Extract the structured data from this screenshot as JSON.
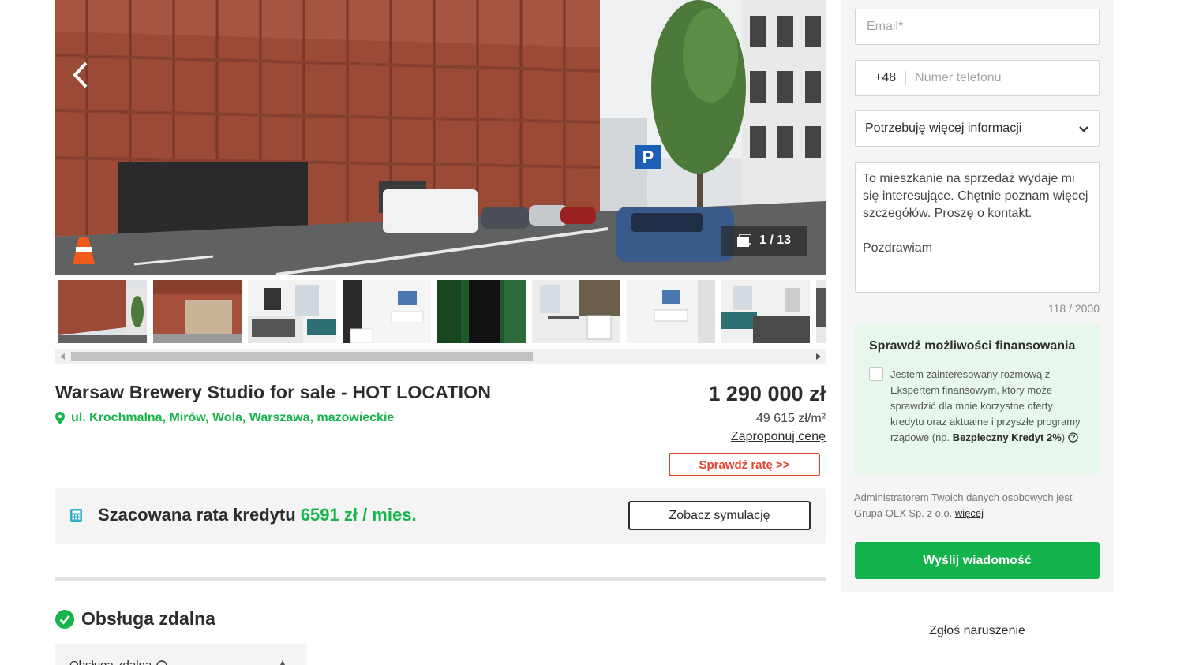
{
  "gallery": {
    "counter": "1 / 13",
    "thumbnail_count": 8
  },
  "listing": {
    "title": "Warsaw Brewery Studio for sale - HOT LOCATION",
    "address": "ul. Krochmalna, Mirów, Wola, Warszawa, mazowieckie",
    "price": "1 290 000 zł",
    "price_per_m2": "49 615 zł/m²",
    "offer_link": "Zaproponuj cenę",
    "rate_button": "Sprawdź ratę >>"
  },
  "credit": {
    "label": "Szacowana rata kredytu",
    "value": "6591 zł / mies.",
    "button": "Zobacz symulację"
  },
  "remote": {
    "heading": "Obsługa zdalna",
    "box_label": "Obsługa zdalna"
  },
  "form": {
    "email_placeholder": "Email*",
    "phone_prefix": "+48",
    "phone_placeholder": "Numer telefonu",
    "select_value": "Potrzebuję więcej informacji",
    "message": "To mieszkanie na sprzedaż wydaje mi się interesujące. Chętnie poznam więcej szczegółów. Proszę o kontakt.\n\nPozdrawiam",
    "char_count": "118 / 2000",
    "send_button": "Wyślij wiadomość"
  },
  "finance": {
    "title": "Sprawdź możliwości finansowania",
    "text": "Jestem zainteresowany rozmową z Ekspertem finansowym, który może sprawdzić dla mnie korzystne oferty kredytu oraz aktualne i przyszłe programy rządowe (np. ",
    "text_bold": "Bezpieczny Kredyt 2%",
    "text_end": ")"
  },
  "gdpr": {
    "text": "Administratorem Twoich danych osobowych jest Grupa OLX Sp. z o.o. ",
    "link": "więcej"
  },
  "footer": {
    "report": "Zgłoś naruszenie"
  },
  "colors": {
    "accent_green": "#17b44b",
    "send_button": "#14b24a",
    "rate_red": "#e2442f",
    "finance_bg": "#e7f7ec"
  }
}
